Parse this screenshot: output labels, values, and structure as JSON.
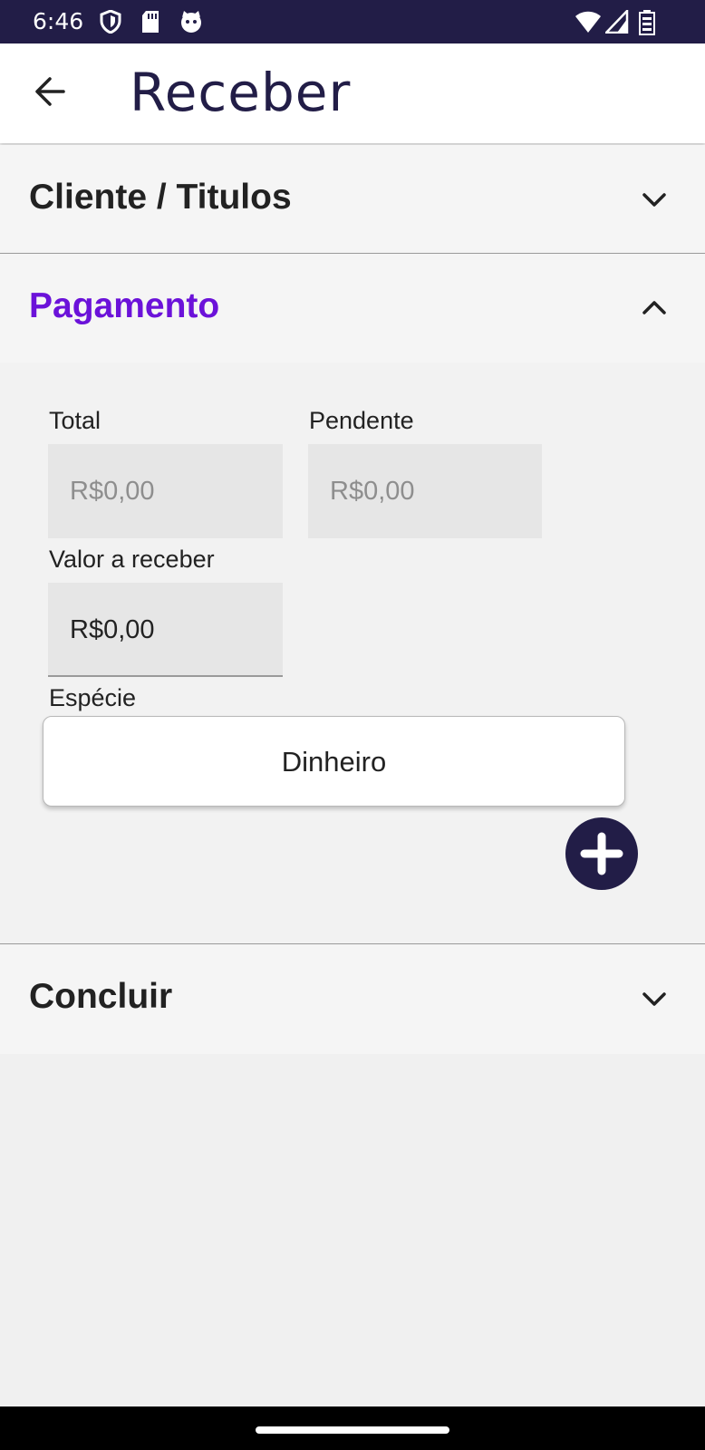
{
  "status_bar": {
    "time": "6:46",
    "icons": [
      "shield-icon",
      "sd-card-icon",
      "cat-face-icon",
      "wifi-icon",
      "signal-icon",
      "battery-icon"
    ]
  },
  "app_bar": {
    "title": "Receber",
    "back_icon": "arrow-left-icon"
  },
  "sections": {
    "cliente": {
      "title": "Cliente / Titulos",
      "expanded": false
    },
    "pagamento": {
      "title": "Pagamento",
      "expanded": true
    },
    "concluir": {
      "title": "Concluir",
      "expanded": false
    }
  },
  "pagamento": {
    "total_label": "Total",
    "total_value": "R$0,00",
    "pendente_label": "Pendente",
    "pendente_value": "R$0,00",
    "valor_label": "Valor a receber",
    "valor_value": "R$0,00",
    "especie_label": "Espécie",
    "especie_value": "Dinheiro",
    "add_icon": "plus-icon"
  },
  "colors": {
    "primary": "#221d47",
    "accent": "#6b12d9",
    "section_bg": "#f5f5f5",
    "field_bg": "#e6e6e6"
  }
}
